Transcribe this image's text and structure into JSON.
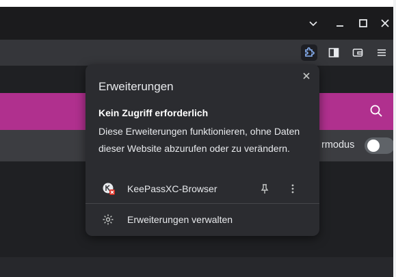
{
  "window": {
    "controls": {
      "dropdown_icon": "chevron-down-icon",
      "minimize_icon": "minimize-icon",
      "maximize_icon": "maximize-icon",
      "close_icon": "close-icon"
    }
  },
  "toolbar": {
    "icons": [
      "extensions-puzzle-icon",
      "side-panel-icon",
      "wallet-icon",
      "menu-icon"
    ]
  },
  "page": {
    "mode_label": "rmodus",
    "toggle_state": "off"
  },
  "popup": {
    "title": "Erweiterungen",
    "subheading": "Kein Zugriff erforderlich",
    "description": "Diese Erweiterungen funktionieren, ohne Daten dieser Website abzurufen oder zu verändern.",
    "extensions": [
      {
        "name": "KeePassXC-Browser",
        "icon": "keepassxc-icon"
      }
    ],
    "manage_label": "Erweiterungen verwalten"
  },
  "colors": {
    "titlebar": "#1b1b1d",
    "toolbar": "#35363a",
    "accent_magenta": "#b0308e",
    "popup_bg": "#2b2c30",
    "text": "#e8eaed"
  }
}
